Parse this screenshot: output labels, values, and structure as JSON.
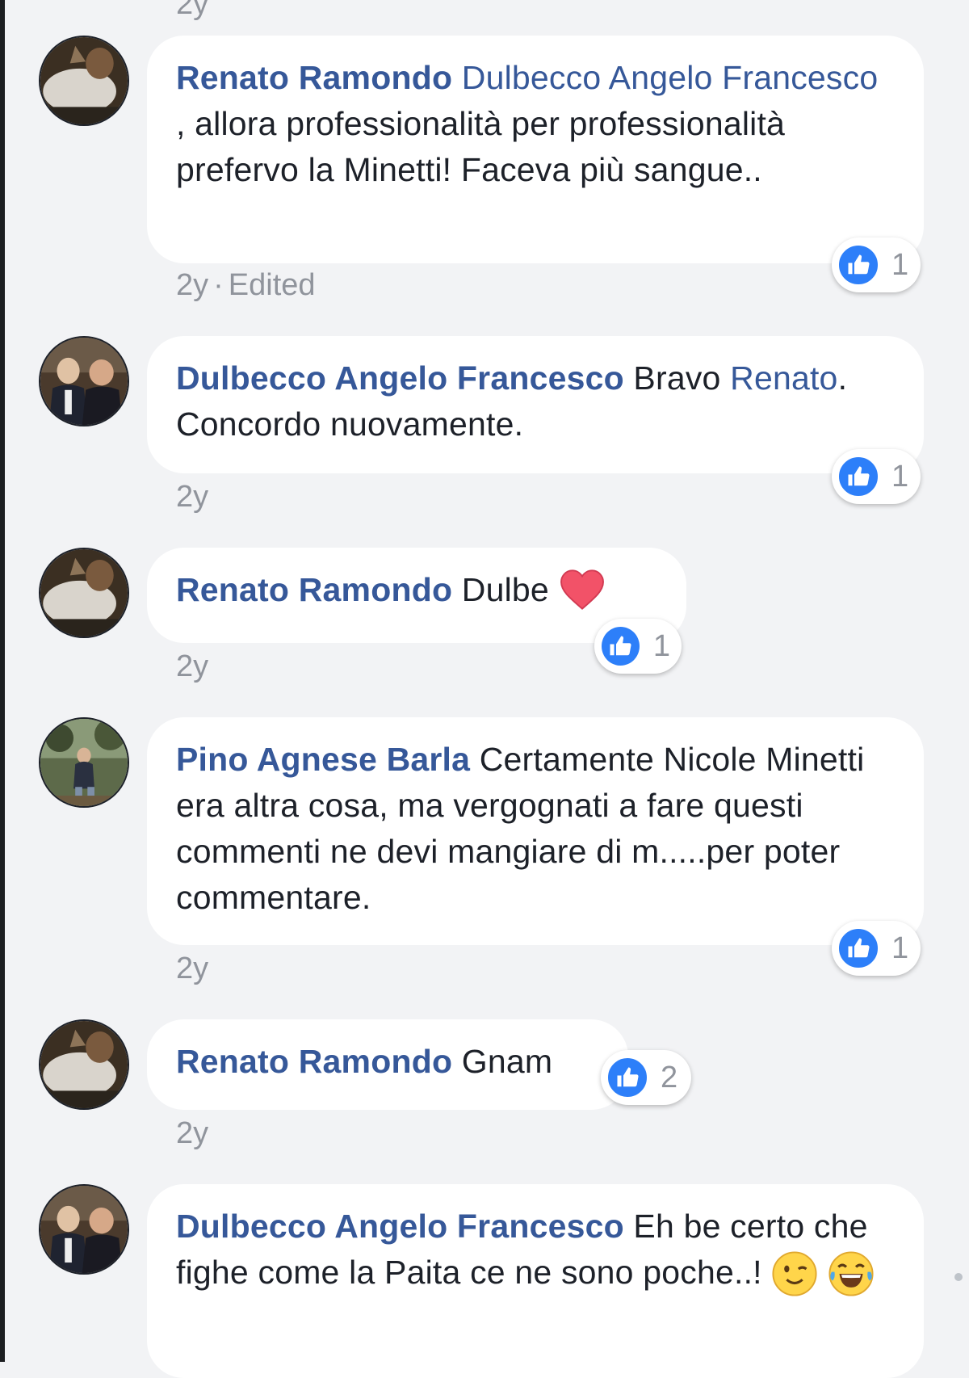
{
  "top_time": "2y",
  "comments": [
    {
      "author": "Renato Ramondo",
      "mention": "Dulbecco Angelo Francesco",
      "text": " , allora professionalità per professionalità prefervo la Minetti! Faceva più sangue..",
      "time": "2y",
      "edited": "Edited",
      "likes": "1"
    },
    {
      "author": "Dulbecco Angelo Francesco",
      "text_before": " Bravo ",
      "mention": "Renato",
      "text": ". Concordo nuovamente.",
      "time": "2y",
      "likes": "1"
    },
    {
      "author": "Renato Ramondo",
      "text": " Dulbe ",
      "emoji": "heart-emoji",
      "time": "2y",
      "likes": "1"
    },
    {
      "author": "Pino Agnese Barla",
      "text": " Certamente Nicole Minetti era altra cosa, ma vergognati a fare questi commenti ne devi mangiare di m.....per poter commentare.",
      "time": "2y",
      "likes": "1"
    },
    {
      "author": "Renato Ramondo",
      "text": " Gnam",
      "time": "2y",
      "likes": "2"
    },
    {
      "author": "Dulbecco Angelo Francesco",
      "text": " Eh be certo che fighe come la Paita ce ne sono poche..! ",
      "emojis": [
        "wink-emoji",
        "laughing-tears-emoji"
      ]
    }
  ],
  "colors": {
    "background": "#f2f3f5",
    "bubble": "#ffffff",
    "author": "#365899",
    "text": "#1d2129",
    "meta": "#90949c",
    "like": "#2d7ff9",
    "heart": "#f25268"
  }
}
